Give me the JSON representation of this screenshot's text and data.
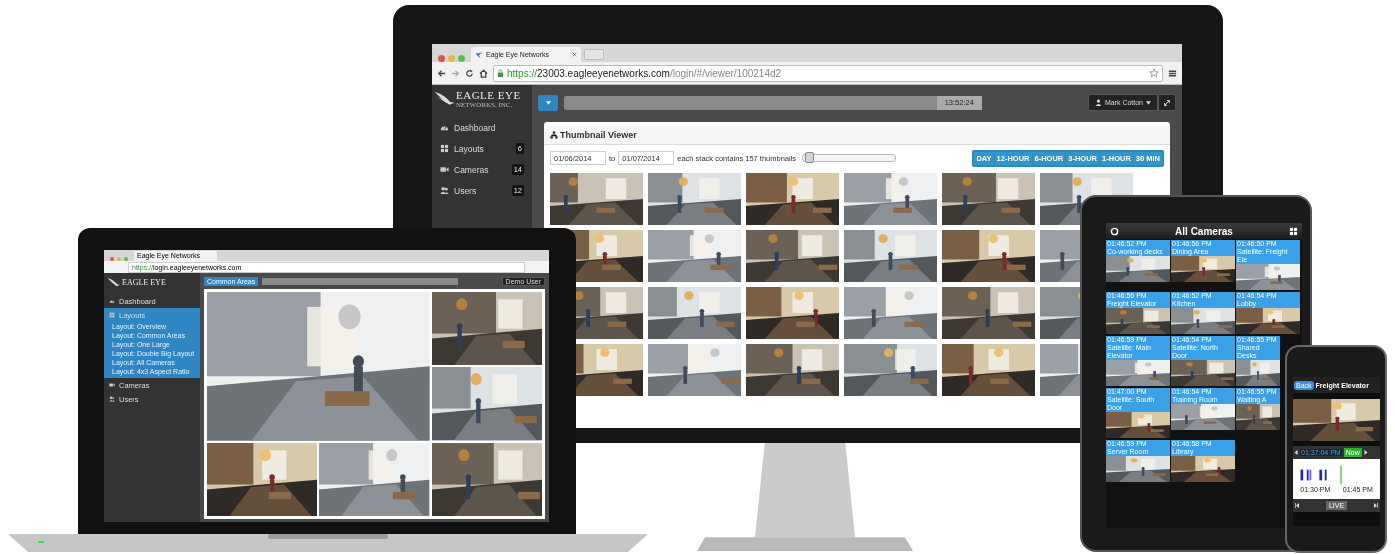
{
  "monitor": {
    "browser": {
      "tab_title": "Eagle Eye Networks",
      "url_scheme": "https://",
      "url_host": "23003.eagleeyenetworks.com",
      "url_path": "/login/#/viewer/100214d2"
    },
    "header": {
      "logo": "EAGLE EYE",
      "logo_sub": "NETWORKS, INC.",
      "clock": "13:52:24",
      "user": "Mark Cotton"
    },
    "sidebar": [
      {
        "label": "Dashboard"
      },
      {
        "label": "Layouts",
        "count": "6"
      },
      {
        "label": "Cameras",
        "count": "14"
      },
      {
        "label": "Users",
        "count": "12"
      }
    ],
    "panel": {
      "title": "Thumbnail Viewer",
      "start_date": "01/06/2014",
      "to": "to",
      "end_date": "01/07/2014",
      "stack_text": "each stack contains 157 thumbnails",
      "stack_slider": {
        "level": 0.03
      },
      "ranges": [
        "DAY",
        "12-HOUR",
        "6-HOUR",
        "3-HOUR",
        "1-HOUR",
        "30 MIN"
      ]
    }
  },
  "laptop": {
    "browser": {
      "tab_title": "Eagle Eye Networks",
      "url_scheme": "https://",
      "url_host": "login.eagleeyenetworks.com"
    },
    "header": {
      "logo": "EAGLE EYE",
      "layout_button": "Common Areas",
      "user": "Demo User"
    },
    "sidebar": [
      {
        "label": "Dashboard",
        "expanded": false
      },
      {
        "label": "Layouts",
        "expanded": true,
        "children": [
          {
            "label": "Layout: Overview"
          },
          {
            "label": "Layout: Common Areas"
          },
          {
            "label": "Layout: One Large"
          },
          {
            "label": "Layout: Double Big Layout"
          },
          {
            "label": "Layout: All Cameras"
          },
          {
            "label": "Layout: 4x3 Aspect Ratio"
          }
        ]
      },
      {
        "label": "Cameras",
        "expanded": false
      },
      {
        "label": "Users",
        "expanded": false
      }
    ]
  },
  "tablet": {
    "title": "All Cameras",
    "cameras": [
      {
        "time": "01:46:52 PM",
        "name": "Co-working desks"
      },
      {
        "time": "01:46:56 PM",
        "name": "Dining Area"
      },
      {
        "time": "01:46:50 PM",
        "name": "Satellite: Freight Ele"
      },
      {
        "time": "01:46:56 PM",
        "name": "Freight Elevator"
      },
      {
        "time": "01:46:52 PM",
        "name": "Kitchen"
      },
      {
        "time": "01:46:54 PM",
        "name": "Lobby"
      },
      {
        "time": "01:46:59 PM",
        "name": "Satellite: Main Elevator"
      },
      {
        "time": "01:46:54 PM",
        "name": "Satellite: North Door"
      },
      {
        "time": "01:46:55 PM",
        "name": "Shared Desks"
      },
      {
        "time": "01:47:00 PM",
        "name": "Satellite: South Door"
      },
      {
        "time": "01:46:54 PM",
        "name": "Training Room"
      },
      {
        "time": "01:46:55 PM",
        "name": "Waiting A"
      },
      {
        "time": "01:46:59 PM",
        "name": "Server Room"
      },
      {
        "time": "01:46:58 PM",
        "name": "Library"
      }
    ]
  },
  "phone": {
    "back": "Back",
    "title": "Freight Elevator",
    "timestamp": "01:37:04 PM",
    "now": "Now",
    "ticks": [
      "01:30 PM",
      "01:45 PM"
    ],
    "live": "LIVE"
  }
}
